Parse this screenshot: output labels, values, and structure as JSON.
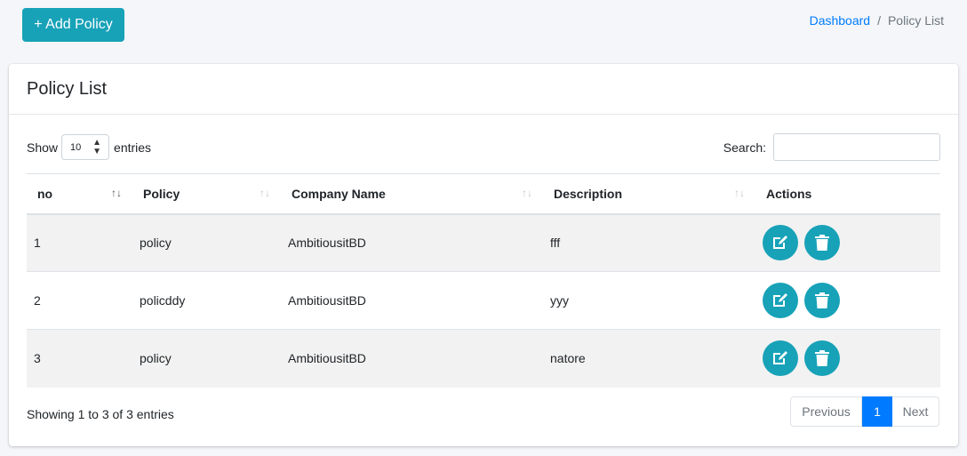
{
  "toolbar": {
    "add_label": "+ Add Policy"
  },
  "breadcrumb": {
    "home": "Dashboard",
    "separator": "/",
    "current": "Policy List"
  },
  "card": {
    "title": "Policy List"
  },
  "length": {
    "show": "Show",
    "value": "10",
    "entries": "entries"
  },
  "search": {
    "label": "Search:",
    "value": ""
  },
  "columns": [
    "no",
    "Policy",
    "Company Name",
    "Description",
    "Actions"
  ],
  "rows": [
    {
      "no": "1",
      "policy": "policy",
      "company": "AmbitiousitBD",
      "description": "fff"
    },
    {
      "no": "2",
      "policy": "policddy",
      "company": "AmbitiousitBD",
      "description": "yyy"
    },
    {
      "no": "3",
      "policy": "policy",
      "company": "AmbitiousitBD",
      "description": "natore"
    }
  ],
  "footer": {
    "info": "Showing 1 to 3 of 3 entries"
  },
  "pagination": {
    "previous": "Previous",
    "current": "1",
    "next": "Next"
  },
  "icons": {
    "edit": "edit-icon",
    "delete": "trash-icon",
    "sort": "sort-icon"
  },
  "colors": {
    "accent": "#17a2b8",
    "primary": "#007bff",
    "stripe": "#f2f2f2"
  }
}
